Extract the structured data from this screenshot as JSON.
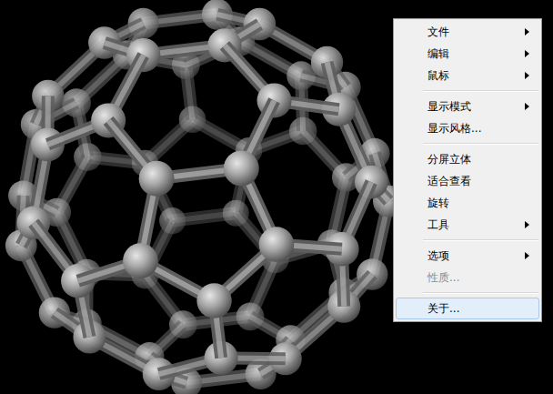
{
  "viewer": {
    "molecule": "C60"
  },
  "context_menu": {
    "items": [
      {
        "kind": "item",
        "label": "文件",
        "has_submenu": true,
        "disabled": false,
        "selected": false
      },
      {
        "kind": "item",
        "label": "编辑",
        "has_submenu": true,
        "disabled": false,
        "selected": false
      },
      {
        "kind": "item",
        "label": "鼠标",
        "has_submenu": true,
        "disabled": false,
        "selected": false
      },
      {
        "kind": "separator"
      },
      {
        "kind": "item",
        "label": "显示模式",
        "has_submenu": true,
        "disabled": false,
        "selected": false
      },
      {
        "kind": "item",
        "label": "显示风格...",
        "has_submenu": false,
        "disabled": false,
        "selected": false
      },
      {
        "kind": "separator"
      },
      {
        "kind": "item",
        "label": "分屏立体",
        "has_submenu": false,
        "disabled": false,
        "selected": false
      },
      {
        "kind": "item",
        "label": "适合查看",
        "has_submenu": false,
        "disabled": false,
        "selected": false
      },
      {
        "kind": "item",
        "label": "旋转",
        "has_submenu": false,
        "disabled": false,
        "selected": false
      },
      {
        "kind": "item",
        "label": "工具",
        "has_submenu": true,
        "disabled": false,
        "selected": false
      },
      {
        "kind": "separator"
      },
      {
        "kind": "item",
        "label": "选项",
        "has_submenu": true,
        "disabled": false,
        "selected": false
      },
      {
        "kind": "item",
        "label": "性质...",
        "has_submenu": false,
        "disabled": true,
        "selected": false
      },
      {
        "kind": "separator"
      },
      {
        "kind": "item",
        "label": "关于...",
        "has_submenu": false,
        "disabled": false,
        "selected": true
      }
    ]
  }
}
